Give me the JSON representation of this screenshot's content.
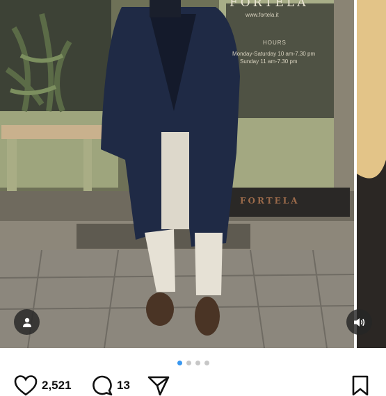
{
  "post": {
    "photo_alt": "Man in navy double-breasted overcoat in front of Fortela shop",
    "storefront": {
      "brand": "FORTELA",
      "url": "www.fortela.it",
      "hours_title": "HOURS",
      "hours_line1": "Monday-Saturday 10 am-7.30 pm",
      "hours_line2": "Sunday 11 am-7.30 pm",
      "doormat": "FORTELA"
    }
  },
  "carousel": {
    "page_count": 4,
    "active_page": 1
  },
  "actions": {
    "likes": "2,521",
    "comments": "13"
  },
  "colors": {
    "accent_blue": "#3897f0",
    "dot_inactive": "#c7c7c7",
    "overlay_button": "#262626"
  },
  "icons": {
    "user_tag": "person-icon",
    "sound": "speaker-icon",
    "like": "heart-icon",
    "comment": "comment-bubble-icon",
    "share": "paper-plane-icon",
    "save": "bookmark-icon"
  }
}
